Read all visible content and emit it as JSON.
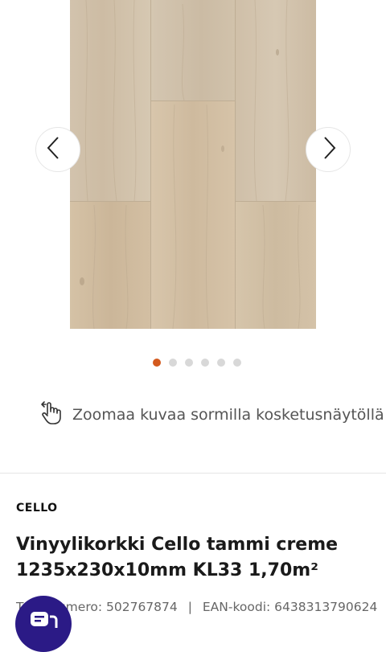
{
  "gallery": {
    "image_alt": "Vinyylikorkki Cello tammi creme",
    "dot_count": 6,
    "active_dot": 1
  },
  "zoom_hint": "Zoomaa kuvaa sormilla kosketusnäytöllä",
  "product": {
    "brand": "CELLO",
    "title": "Vinyylikorkki Cello tammi creme 1235x230x10mm KL33 1,70m²",
    "product_number_label": "Tuotenumero:",
    "product_number": "502767874",
    "separator": "|",
    "ean_label": "EAN-koodi:",
    "ean": "6438313790624"
  },
  "colors": {
    "accent_dot": "#d35a1e",
    "chat_button": "#2b1a86"
  },
  "icons": {
    "prev": "chevron-left-icon",
    "next": "chevron-right-icon",
    "zoom": "hand-pinch-icon",
    "chat": "chat-icon"
  }
}
